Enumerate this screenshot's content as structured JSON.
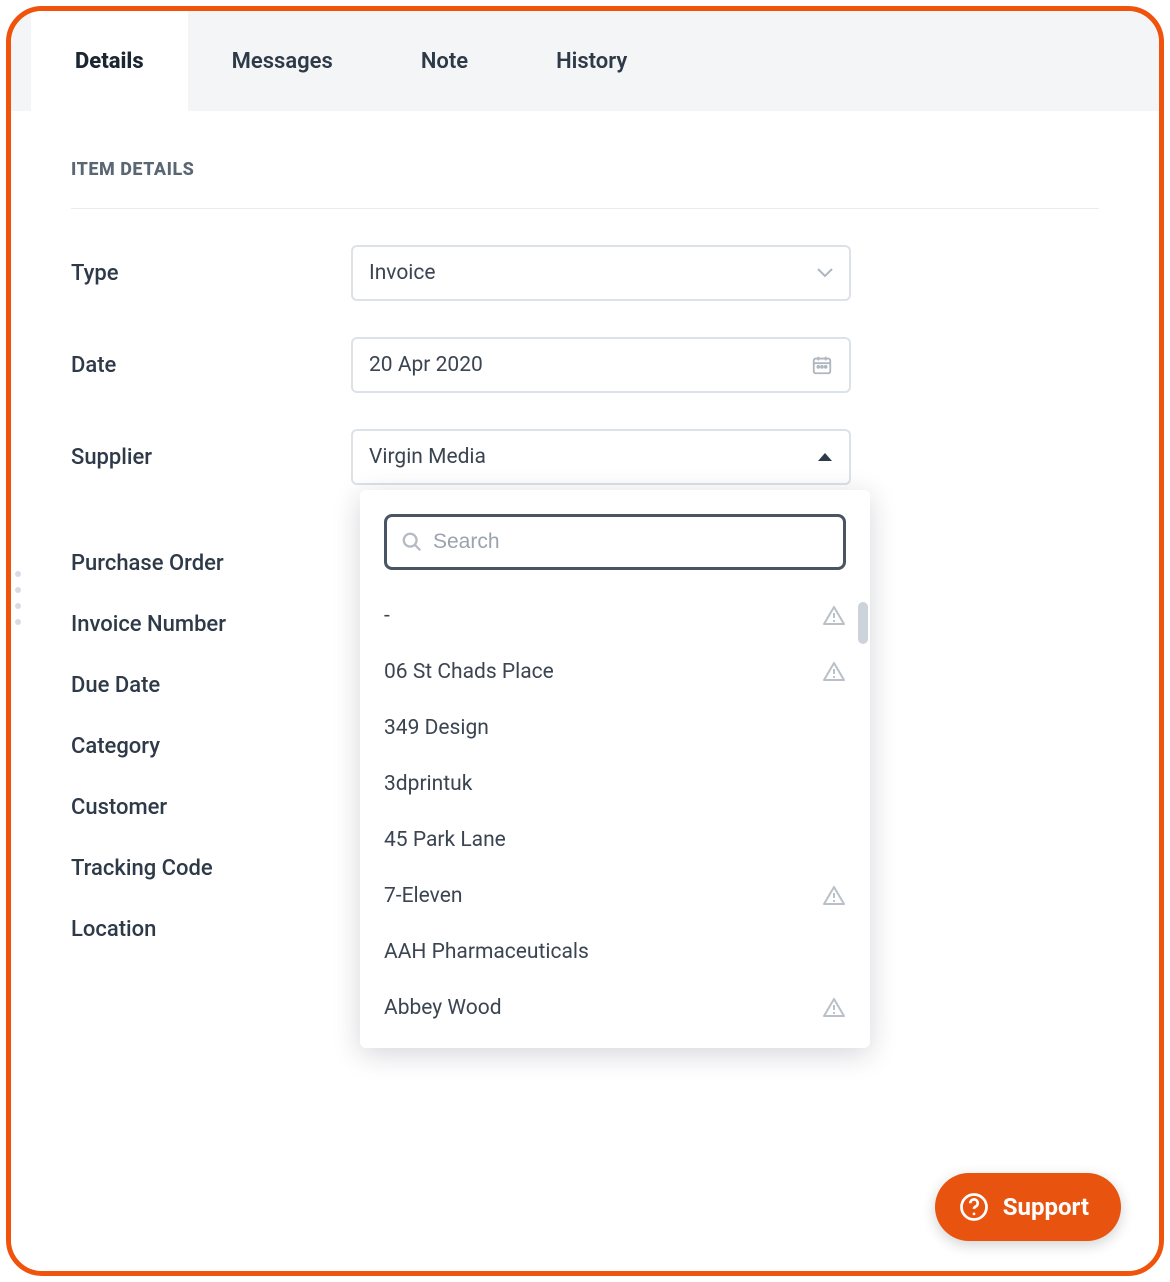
{
  "tabs": [
    {
      "label": "Details",
      "active": true
    },
    {
      "label": "Messages",
      "active": false
    },
    {
      "label": "Note",
      "active": false
    },
    {
      "label": "History",
      "active": false
    }
  ],
  "section_title": "ITEM DETAILS",
  "fields": {
    "type": {
      "label": "Type",
      "value": "Invoice"
    },
    "date": {
      "label": "Date",
      "value": "20 Apr 2020"
    },
    "supplier": {
      "label": "Supplier",
      "value": "Virgin Media"
    },
    "purchase_order": {
      "label": "Purchase Order"
    },
    "invoice_number": {
      "label": "Invoice Number"
    },
    "due_date": {
      "label": "Due Date"
    },
    "category": {
      "label": "Category"
    },
    "customer": {
      "label": "Customer"
    },
    "tracking_code": {
      "label": "Tracking Code"
    },
    "location": {
      "label": "Location"
    }
  },
  "dropdown": {
    "search_placeholder": "Search",
    "options": [
      {
        "label": "-",
        "warning": true
      },
      {
        "label": "06 St Chads Place",
        "warning": true
      },
      {
        "label": "349 Design",
        "warning": false
      },
      {
        "label": "3dprintuk",
        "warning": false
      },
      {
        "label": "45 Park Lane",
        "warning": false
      },
      {
        "label": "7-Eleven",
        "warning": true
      },
      {
        "label": "AAH Pharmaceuticals",
        "warning": false
      },
      {
        "label": "Abbey Wood",
        "warning": true
      }
    ]
  },
  "support_label": "Support"
}
